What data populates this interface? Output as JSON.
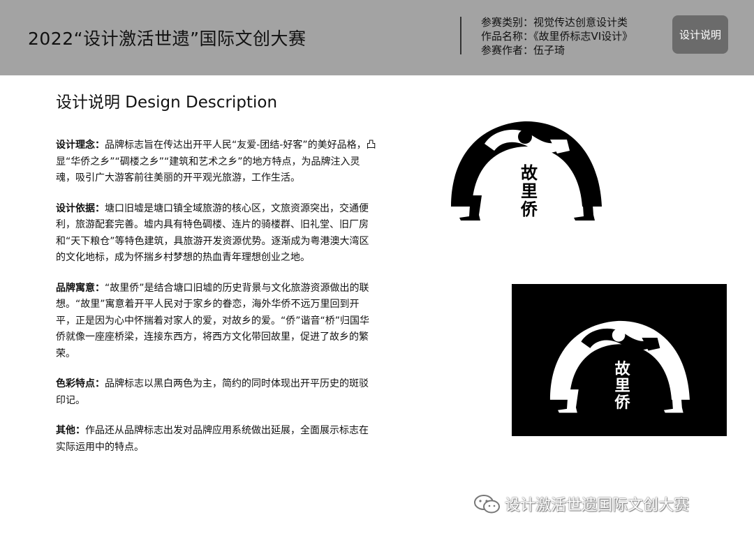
{
  "header": {
    "title": "2022“设计激活世遗”国际文创大赛",
    "meta": {
      "category": "参赛类别：视觉传达创意设计类",
      "work_name": "作品名称：《故里侨标志VI设计》",
      "author": "参赛作者：伍子琦"
    },
    "button_label": "设计说明"
  },
  "section": {
    "title": "设计说明 Design Description"
  },
  "paragraphs": [
    {
      "label": "设计理念：",
      "text": "品牌标志旨在传达出开平人民“友爱-团结-好客”的美好品格，凸显“华侨之乡”“碉楼之乡”“建筑和艺术之乡”的地方特点，为品牌注入灵魂，吸引广大游客前往美丽的开平观光旅游，工作生活。"
    },
    {
      "label": "设计依据：",
      "text": "塘口旧墟是塘口镇全域旅游的核心区，文旅资源突出，交通便利，旅游配套完善。墟内具有特色碉楼、连片的骑楼群、旧礼堂、旧厂房和“天下粮仓”等特色建筑，具旅游开发资源优势。逐渐成为粤港澳大湾区的文化地标，成为怀揣乡村梦想的热血青年理想创业之地。"
    },
    {
      "label": "品牌寓意：",
      "text": "“故里侨”是结合塘口旧墟的历史背景与文化旅游资源做出的联想。“故里”寓意着开平人民对于家乡的眷恋，海外华侨不远万里回到开平，正是因为心中怀揣着对家人的爱，对故乡的爱。“侨”谐音“桥”归国华侨就像一座座桥梁，连接东西方，将西方文化带回故里，促进了故乡的繁荣。"
    },
    {
      "label": "色彩特点：",
      "text": "品牌标志以黑白两色为主，简约的同时体现出开平历史的斑驳印记。"
    },
    {
      "label": "其他：",
      "text": "作品还从品牌标志出发对品牌应用系统做出延展，全面展示标志在实际运用中的特点。"
    }
  ],
  "logo": {
    "text": [
      "故",
      "里",
      "侨"
    ]
  },
  "watermark": {
    "text": "设计激活世遗国际文创大赛"
  }
}
